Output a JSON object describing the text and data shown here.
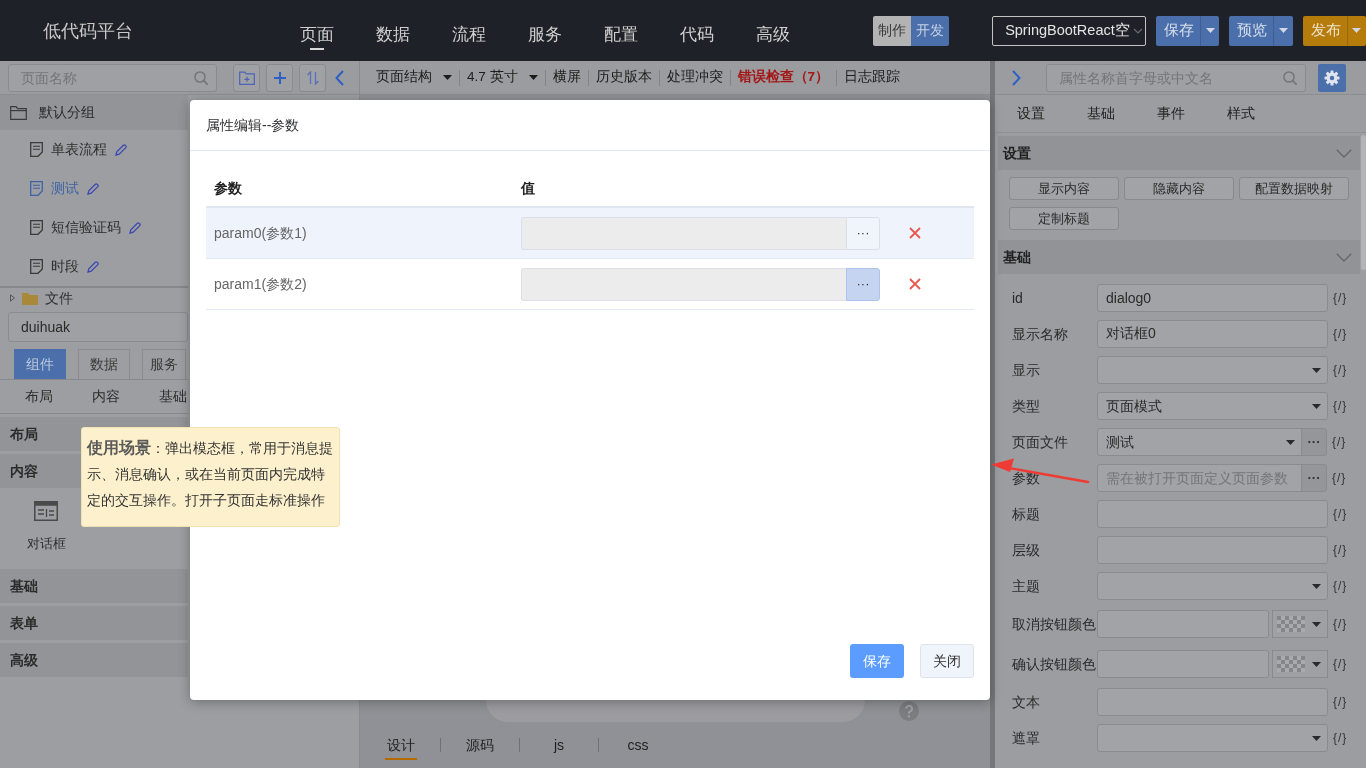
{
  "header": {
    "logo": "低代码平台",
    "nav": [
      {
        "label": "页面",
        "selected": true
      },
      {
        "label": "数据",
        "selected": false
      },
      {
        "label": "流程",
        "selected": false
      },
      {
        "label": "服务",
        "selected": false
      },
      {
        "label": "配置",
        "selected": false
      },
      {
        "label": "代码",
        "selected": false
      },
      {
        "label": "高级",
        "selected": false
      }
    ],
    "mode_toggle": [
      {
        "label": "制作",
        "selected": false
      },
      {
        "label": "开发",
        "selected": true
      }
    ],
    "project_select": {
      "value": "SpringBootReact空"
    },
    "actions": [
      {
        "label": "保存",
        "color": "#4a6fab"
      },
      {
        "label": "预览",
        "color": "#4a6fab"
      },
      {
        "label": "发布",
        "color": "#b57b0b"
      }
    ]
  },
  "page_tree": {
    "search": {
      "placeholder": "页面名称"
    },
    "nodes": [
      {
        "label": "默认分组",
        "kind": "group",
        "collapsed": false,
        "children": [
          {
            "label": "单表流程",
            "selected": false
          },
          {
            "label": "测试",
            "selected": true
          },
          {
            "label": "短信验证码",
            "selected": false
          },
          {
            "label": "时段",
            "selected": false
          }
        ]
      },
      {
        "label": "文件",
        "kind": "folder",
        "collapsed": true
      }
    ]
  },
  "component_panel": {
    "filter": {
      "value": "duihuak"
    },
    "tabs": [
      {
        "label": "组件",
        "selected": true
      },
      {
        "label": "数据",
        "selected": false
      },
      {
        "label": "服务",
        "selected": false
      }
    ],
    "category_tabs": [
      {
        "label": "布局"
      },
      {
        "label": "内容"
      },
      {
        "label": "基础"
      }
    ],
    "categories": [
      {
        "label": "布局"
      },
      {
        "label": "内容",
        "components": [
          {
            "label": "对话框"
          }
        ]
      },
      {
        "label": "基础"
      },
      {
        "label": "表单"
      },
      {
        "label": "高级"
      }
    ]
  },
  "tooltip": {
    "text": "**使用场景**：弹出模态框，常用于消息提示、消息确认，或在当前页面内完成特定的交互操作。打开子页面走标准操作"
  },
  "toolbar": {
    "items": [
      {
        "label": "页面结构",
        "kind": "dropdown"
      },
      {
        "label": "4.7 英寸",
        "kind": "dropdown"
      },
      {
        "label": "横屏",
        "kind": "link"
      },
      {
        "label": "历史版本",
        "kind": "link"
      },
      {
        "label": "处理冲突",
        "kind": "link"
      },
      {
        "label": "错误检查（7）",
        "kind": "error"
      },
      {
        "label": "日志跟踪",
        "kind": "link"
      }
    ]
  },
  "canvas_tabs": [
    {
      "label": "设计",
      "selected": true
    },
    {
      "label": "源码",
      "selected": false
    },
    {
      "label": "js",
      "selected": false
    },
    {
      "label": "css",
      "selected": false
    }
  ],
  "dialog": {
    "title": "属性编辑--参数",
    "columns": [
      "参数",
      "值"
    ],
    "rows": [
      {
        "name": "param0(参数1)",
        "selected": true,
        "picker": {
          "label": "···",
          "pressed": false
        }
      },
      {
        "name": "param1(参数2)",
        "selected": false,
        "picker": {
          "label": "···",
          "pressed": true
        }
      }
    ],
    "buttons": [
      {
        "label": "保存",
        "kind": "primary"
      },
      {
        "label": "关闭",
        "kind": "secondary"
      }
    ]
  },
  "properties": {
    "search": {
      "placeholder": "属性名称首字母或中文名"
    },
    "tabs": [
      {
        "label": "设置"
      },
      {
        "label": "基础"
      },
      {
        "label": "事件"
      },
      {
        "label": "样式"
      }
    ],
    "sections": [
      {
        "title": "设置",
        "expanded": true,
        "kind": "buttons",
        "buttons": [
          "显示内容",
          "隐藏内容",
          "配置数据映射",
          "定制标题"
        ]
      },
      {
        "title": "基础",
        "expanded": true,
        "kind": "form",
        "fields": [
          {
            "label": "id",
            "kind": "text",
            "value": "dialog0",
            "code": "{/}"
          },
          {
            "label": "显示名称",
            "kind": "text",
            "value": "对话框0",
            "code": "{/}"
          },
          {
            "label": "显示",
            "kind": "select",
            "code": "{/}"
          },
          {
            "label": "类型",
            "kind": "select",
            "value": "页面模式",
            "code": "{/}"
          },
          {
            "label": "页面文件",
            "kind": "select",
            "value": "测试",
            "picker": "···",
            "code": "{/}"
          },
          {
            "label": "参数",
            "kind": "text",
            "placeholder": "需在被打开页面定义页面参数",
            "picker": "···",
            "code": "{/}"
          },
          {
            "label": "标题",
            "kind": "text",
            "code": "{/}"
          },
          {
            "label": "层级",
            "kind": "text",
            "code": "{/}"
          },
          {
            "label": "主题",
            "kind": "select",
            "code": "{/}"
          },
          {
            "label": "取消按钮颜色",
            "kind": "color",
            "code": "{/}"
          },
          {
            "label": "确认按钮颜色",
            "kind": "color",
            "code": "{/}"
          },
          {
            "label": "文本",
            "kind": "text",
            "code": "{/}"
          },
          {
            "label": "遮罩",
            "kind": "select",
            "code": "{/}"
          }
        ]
      }
    ]
  }
}
